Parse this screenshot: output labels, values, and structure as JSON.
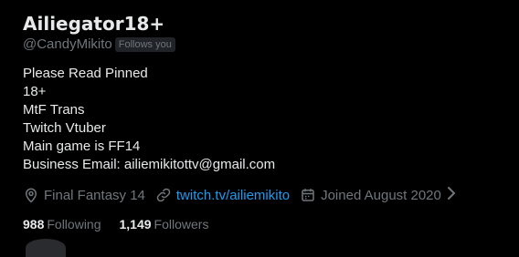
{
  "profile": {
    "display_name": "Ailiegator18+",
    "handle": "@CandyMikito",
    "follows_you_badge": "Follows you",
    "bio_lines": [
      "Please Read Pinned",
      "18+",
      "MtF Trans",
      "Twitch Vtuber",
      "Main game is FF14",
      "Business Email: ailiemikitottv@gmail.com"
    ],
    "location": "Final Fantasy 14",
    "website": "twitch.tv/ailiemikito",
    "joined": "Joined August 2020",
    "following_count": "988",
    "following_label": "Following",
    "followers_count": "1,149",
    "followers_label": "Followers"
  },
  "colors": {
    "background": "#000000",
    "primary_text": "#e7e9ea",
    "secondary_text": "#71767b",
    "link": "#1d9bf0",
    "badge_bg": "#202327"
  },
  "icons": {
    "location": "location-pin-icon",
    "website": "link-icon",
    "joined": "calendar-icon",
    "more": "chevron-right-icon"
  }
}
